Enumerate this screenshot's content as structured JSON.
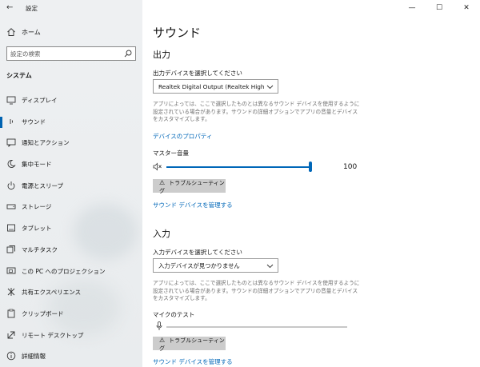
{
  "app": {
    "title": "設定"
  },
  "window": {
    "minimize": "—",
    "maximize": "☐",
    "close": "✕"
  },
  "nav": {
    "home": "ホーム",
    "search_placeholder": "設定の検索",
    "section": "システム",
    "items": [
      {
        "label": "ディスプレイ",
        "icon": "monitor-icon"
      },
      {
        "label": "サウンド",
        "icon": "speaker-icon",
        "active": true
      },
      {
        "label": "通知とアクション",
        "icon": "notification-icon"
      },
      {
        "label": "集中モード",
        "icon": "moon-icon"
      },
      {
        "label": "電源とスリープ",
        "icon": "power-icon"
      },
      {
        "label": "ストレージ",
        "icon": "storage-icon"
      },
      {
        "label": "タブレット",
        "icon": "tablet-icon"
      },
      {
        "label": "マルチタスク",
        "icon": "multitask-icon"
      },
      {
        "label": "この PC へのプロジェクション",
        "icon": "projection-icon"
      },
      {
        "label": "共有エクスペリエンス",
        "icon": "share-icon"
      },
      {
        "label": "クリップボード",
        "icon": "clipboard-icon"
      },
      {
        "label": "リモート デスクトップ",
        "icon": "remote-icon"
      },
      {
        "label": "詳細情報",
        "icon": "info-icon"
      }
    ]
  },
  "main": {
    "title": "サウンド",
    "output": {
      "heading": "出力",
      "device_label": "出力デバイスを選択してください",
      "device_value": "Realtek Digital Output (Realtek High...",
      "description": "アプリによっては、ここで選択したものとは異なるサウンド デバイスを使用するように設定されている場合があります。サウンドの詳細オプションでアプリの音量とデバイスをカスタマイズします。",
      "properties_link": "デバイスのプロパティ",
      "master_volume_label": "マスター音量",
      "volume_value": "100",
      "volume_level": 100,
      "troubleshoot": "トラブルシューティング",
      "manage_link": "サウンド デバイスを管理する"
    },
    "input": {
      "heading": "入力",
      "device_label": "入力デバイスを選択してください",
      "device_value": "入力デバイスが見つかりません",
      "description": "アプリによっては、ここで選択したものとは異なるサウンド デバイスを使用するように設定されている場合があります。サウンドの詳細オプションでアプリの音量とデバイスをカスタマイズします。",
      "mic_test_label": "マイクのテスト",
      "mic_level": 0,
      "troubleshoot": "トラブルシューティング",
      "manage_link": "サウンド デバイスを管理する"
    }
  },
  "colors": {
    "accent": "#0067b8",
    "sidebar_bg": "#eef0f2",
    "button_bg": "#cccccc"
  }
}
